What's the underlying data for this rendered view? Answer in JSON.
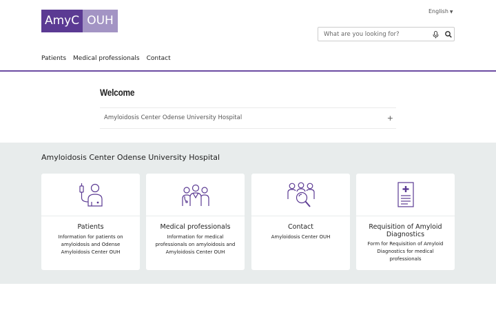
{
  "logo": {
    "part1": "AmyC",
    "part2": "OUH"
  },
  "language": {
    "label": "English"
  },
  "search": {
    "placeholder": "What are you looking for?"
  },
  "nav": [
    {
      "label": "Patients"
    },
    {
      "label": "Medical professionals"
    },
    {
      "label": "Contact"
    }
  ],
  "welcome": {
    "title": "Welcome"
  },
  "accordion": {
    "label": "Amyloidosis Center Odense University Hospital",
    "icon": "plus-icon"
  },
  "section": {
    "title": "Amyloidosis Center Odense University Hospital"
  },
  "cards": [
    {
      "title": "Patients",
      "desc": "Information for patients on amyloidosis and Odense Amyloidosis Center OUH",
      "icon": "patient-icon"
    },
    {
      "title": "Medical professionals",
      "desc": "Information for medical professionals on amyloidosis and Amyloidosis Center OUH",
      "icon": "doctors-icon"
    },
    {
      "title": "Contact",
      "desc": "Amyloidosis Center OUH",
      "icon": "people-search-icon"
    },
    {
      "title": "Requisition of Amyloid Diagnostics",
      "desc": "Form for Requisition of Amyloid Diagnostics for medical professionals",
      "icon": "medical-form-icon"
    }
  ],
  "colors": {
    "brand": "#5b3a93",
    "brand_light": "#a394c4",
    "band": "#e8ecec",
    "icon": "#5b3a93"
  }
}
